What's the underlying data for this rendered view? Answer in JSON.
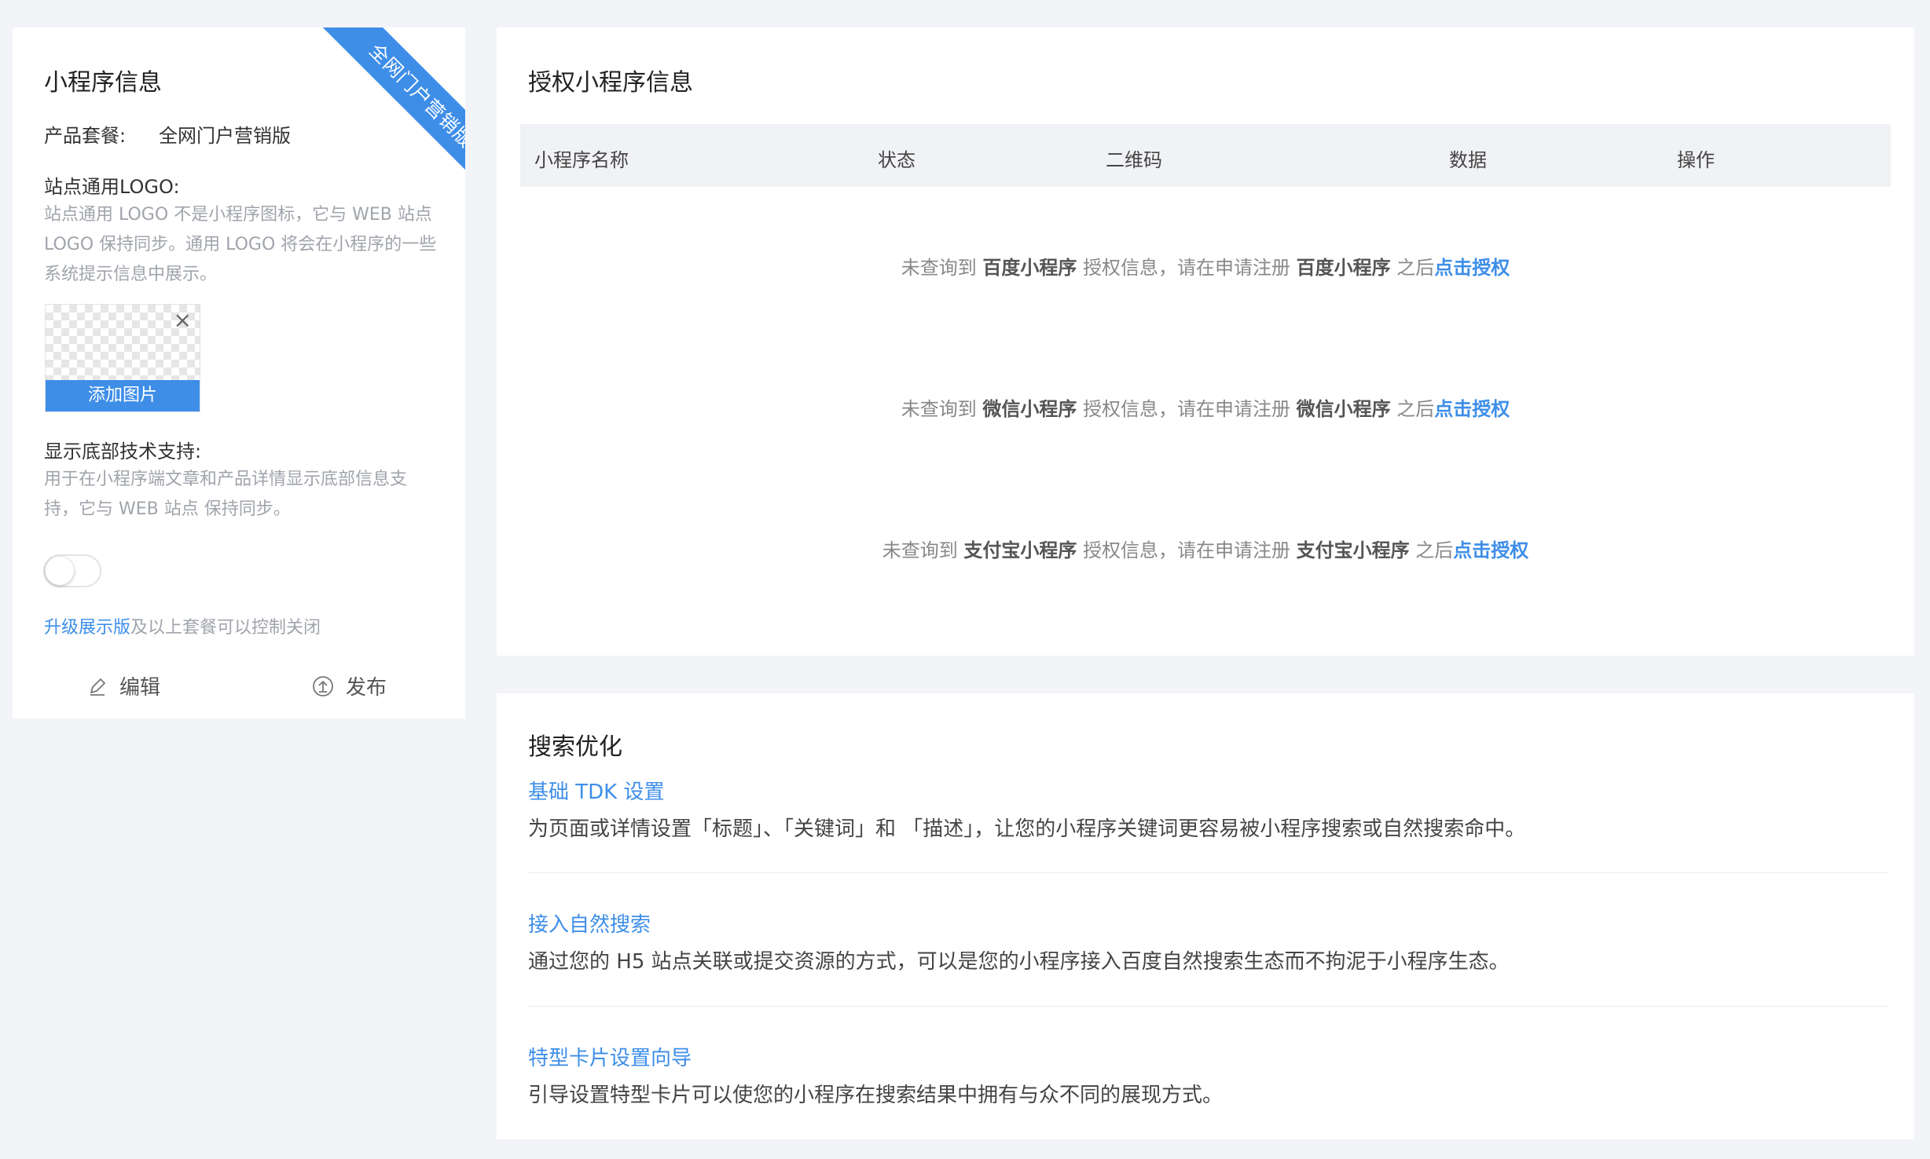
{
  "left": {
    "ribbon": "全网门户营销版",
    "title": "小程序信息",
    "package_label": "产品套餐:",
    "package_value": "全网门户营销版",
    "logo_label": "站点通用LOGO:",
    "logo_help": "站点通用 LOGO 不是小程序图标，它与 WEB 站点 LOGO 保持同步。通用 LOGO 将会在小程序的一些系统提示信息中展示。",
    "add_image": "添加图片",
    "close_glyph": "×",
    "footer_label": "显示底部技术支持:",
    "footer_help": "用于在小程序端文章和产品详情显示底部信息支持，它与 WEB 站点 保持同步。",
    "footer_toggle_on": false,
    "upgrade_link": "升级展示版",
    "upgrade_rest": "及以上套餐可以控制关闭",
    "edit": "编辑",
    "publish": "发布"
  },
  "auth": {
    "title": "授权小程序信息",
    "columns": [
      "小程序名称",
      "状态",
      "二维码",
      "数据",
      "操作"
    ],
    "rows": [
      {
        "pre": "未查询到 ",
        "name1": "百度小程序",
        "mid": " 授权信息，请在申请注册 ",
        "name2": "百度小程序",
        "post": " 之后",
        "action": "点击授权"
      },
      {
        "pre": "未查询到 ",
        "name1": "微信小程序",
        "mid": " 授权信息，请在申请注册 ",
        "name2": "微信小程序",
        "post": " 之后",
        "action": "点击授权"
      },
      {
        "pre": "未查询到 ",
        "name1": "支付宝小程序",
        "mid": " 授权信息，请在申请注册 ",
        "name2": "支付宝小程序",
        "post": " 之后",
        "action": "点击授权"
      }
    ]
  },
  "seo": {
    "title": "搜索优化",
    "items": [
      {
        "link": "基础 TDK 设置",
        "desc": "为页面或详情设置「标题」、「关键词」和 「描述」，让您的小程序关键词更容易被小程序搜索或自然搜索命中。"
      },
      {
        "link": "接入自然搜索",
        "desc": "通过您的 H5 站点关联或提交资源的方式，可以是您的小程序接入百度自然搜索生态而不拘泥于小程序生态。"
      },
      {
        "link": "特型卡片设置向导",
        "desc": "引导设置特型卡片可以使您的小程序在搜索结果中拥有与众不同的展现方式。"
      }
    ]
  },
  "colors": {
    "accent": "#3e8ee8",
    "page_bg": "#f3f4f7",
    "table_head_bg": "#f1f2f5"
  },
  "icons": [
    "close-icon",
    "edit-icon",
    "publish-icon"
  ]
}
